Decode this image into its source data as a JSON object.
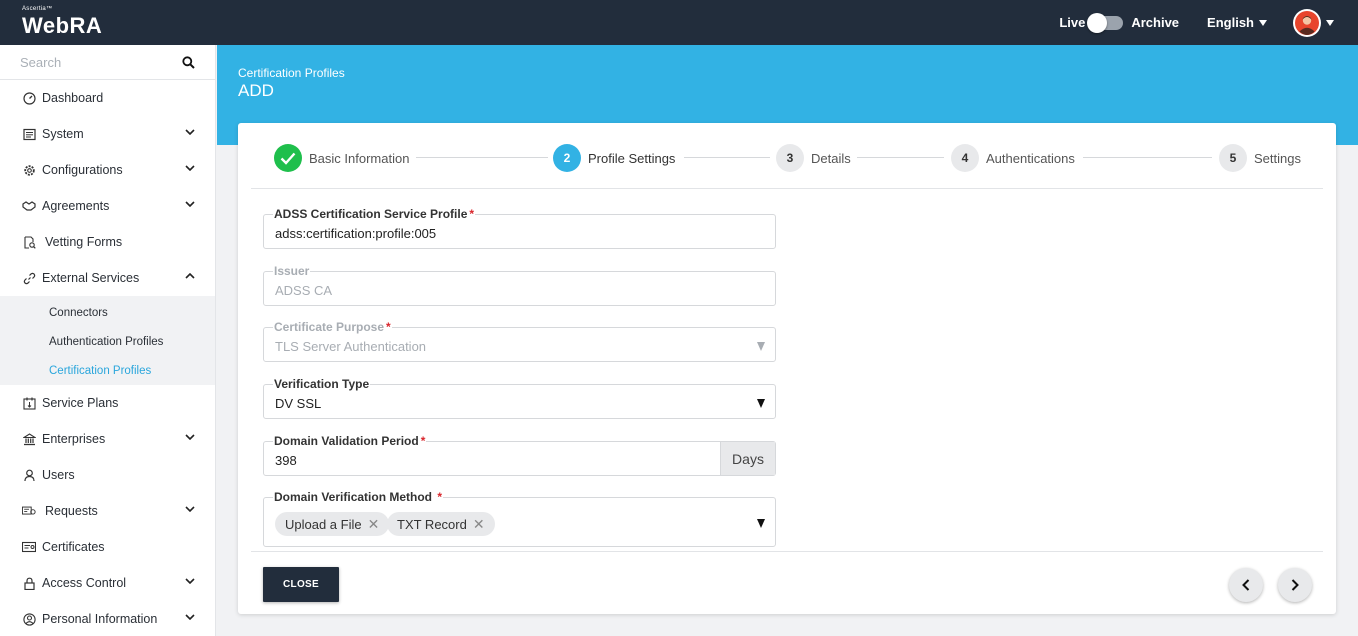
{
  "app": {
    "brand_small": "Ascertia™",
    "brand": "WebRA"
  },
  "topbar": {
    "live_label": "Live",
    "archive_label": "Archive",
    "language": "English"
  },
  "sidebar": {
    "search_placeholder": "Search",
    "items": [
      {
        "label": "Dashboard"
      },
      {
        "label": "System"
      },
      {
        "label": "Configurations"
      },
      {
        "label": "Agreements"
      },
      {
        "label": "Vetting Forms"
      },
      {
        "label": "External Services"
      },
      {
        "label": "Service Plans"
      },
      {
        "label": "Enterprises"
      },
      {
        "label": "Users"
      },
      {
        "label": "Requests"
      },
      {
        "label": "Certificates"
      },
      {
        "label": "Access Control"
      },
      {
        "label": "Personal Information"
      }
    ],
    "sub_items": [
      {
        "label": "Connectors"
      },
      {
        "label": "Authentication Profiles"
      },
      {
        "label": "Certification Profiles"
      }
    ]
  },
  "header": {
    "breadcrumb": "Certification Profiles",
    "title": "ADD"
  },
  "steps": [
    {
      "label": "Basic Information",
      "status": "done"
    },
    {
      "number": "2",
      "label": "Profile Settings",
      "status": "current"
    },
    {
      "number": "3",
      "label": "Details",
      "status": "pending"
    },
    {
      "number": "4",
      "label": "Authentications",
      "status": "pending"
    },
    {
      "number": "5",
      "label": "Settings",
      "status": "pending"
    }
  ],
  "form": {
    "adss_profile": {
      "label": "ADSS Certification Service Profile",
      "value": "adss:certification:profile:005"
    },
    "issuer": {
      "label": "Issuer",
      "value": "ADSS CA"
    },
    "purpose": {
      "label": "Certificate Purpose",
      "value": "TLS Server Authentication"
    },
    "verification_type": {
      "label": "Verification Type",
      "value": "DV SSL"
    },
    "validation_period": {
      "label": "Domain Validation Period",
      "value": "398",
      "unit": "Days"
    },
    "verification_method": {
      "label": "Domain Verification Method",
      "chips": [
        "Upload a File",
        "TXT Record"
      ]
    }
  },
  "footer": {
    "close_label": "CLOSE"
  },
  "colors": {
    "accent": "#32b2e4",
    "dark": "#222d3c",
    "success": "#1fbf4c",
    "required": "#d9262c"
  }
}
